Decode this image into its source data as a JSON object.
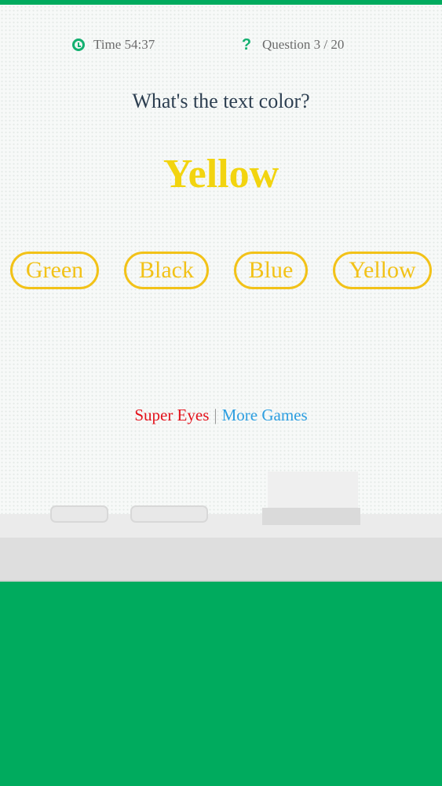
{
  "status": {
    "time_label": "Time 54:37",
    "question_label": "Question 3 / 20",
    "time_icon": "clock-icon",
    "question_icon": "question-mark-icon"
  },
  "prompt": "What's the text color?",
  "target_word": {
    "text": "Yellow",
    "color": "#f2d40f"
  },
  "options": [
    {
      "label": "Green"
    },
    {
      "label": "Black"
    },
    {
      "label": "Blue"
    },
    {
      "label": "Yellow"
    }
  ],
  "links": {
    "super_eyes": "Super Eyes",
    "separator": "|",
    "more_games": "More Games"
  },
  "colors": {
    "brand_green": "#00ab5e",
    "option_border": "#f2c218",
    "prompt_text": "#2c3e50",
    "link_red": "#e3121b",
    "link_blue": "#2c9ee0"
  }
}
